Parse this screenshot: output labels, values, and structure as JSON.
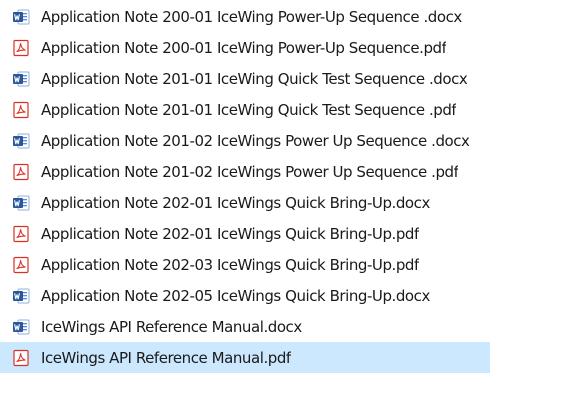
{
  "files": [
    {
      "name": "Application Note 200-01 IceWing Power-Up Sequence .docx",
      "type": "docx",
      "icon": "word-document-icon"
    },
    {
      "name": "Application Note 200-01 IceWing Power-Up Sequence.pdf",
      "type": "pdf",
      "icon": "pdf-document-icon"
    },
    {
      "name": "Application Note 201-01 IceWing Quick Test Sequence .docx",
      "type": "docx",
      "icon": "word-document-icon"
    },
    {
      "name": "Application Note 201-01 IceWing Quick Test Sequence .pdf",
      "type": "pdf",
      "icon": "pdf-document-icon"
    },
    {
      "name": "Application Note 201-02 IceWings Power Up Sequence .docx",
      "type": "docx",
      "icon": "word-document-icon"
    },
    {
      "name": "Application Note 201-02 IceWings Power Up Sequence .pdf",
      "type": "pdf",
      "icon": "pdf-document-icon"
    },
    {
      "name": "Application Note 202-01 IceWings Quick Bring-Up.docx",
      "type": "docx",
      "icon": "word-document-icon"
    },
    {
      "name": "Application Note 202-01 IceWings Quick Bring-Up.pdf",
      "type": "pdf",
      "icon": "pdf-document-icon"
    },
    {
      "name": "Application Note 202-03 IceWings Quick Bring-Up.pdf",
      "type": "pdf",
      "icon": "pdf-document-icon"
    },
    {
      "name": "Application Note 202-05 IceWings Quick Bring-Up.docx",
      "type": "docx",
      "icon": "word-document-icon"
    },
    {
      "name": "IceWings API Reference Manual.docx",
      "type": "docx",
      "icon": "word-document-icon"
    },
    {
      "name": "IceWings API Reference Manual.pdf",
      "type": "pdf",
      "icon": "pdf-document-icon",
      "selected": true
    }
  ],
  "colors": {
    "selection": "#cce8ff",
    "word_blue": "#2b579a",
    "pdf_red": "#d93025",
    "text": "#1a1a1a"
  }
}
